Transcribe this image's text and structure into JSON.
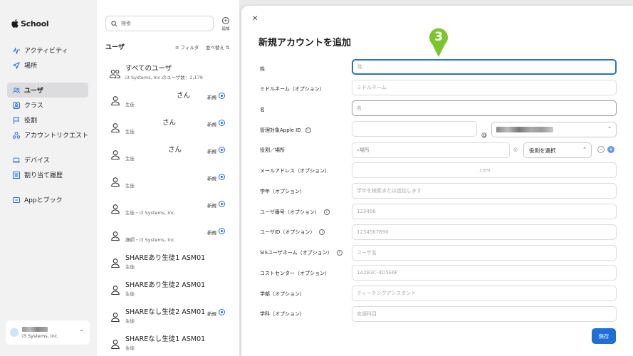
{
  "sidebar": {
    "app_name": "School",
    "items": [
      {
        "label": "アクティビティ",
        "icon": "activity-icon"
      },
      {
        "label": "場所",
        "icon": "location-icon"
      },
      {
        "label": "ユーザ",
        "icon": "users-icon",
        "active": true
      },
      {
        "label": "クラス",
        "icon": "class-icon"
      },
      {
        "label": "役割",
        "icon": "flag-icon"
      },
      {
        "label": "アカウントリクエスト",
        "icon": "account-request-icon"
      },
      {
        "label": "デバイス",
        "icon": "laptop-icon"
      },
      {
        "label": "割り当て履歴",
        "icon": "history-icon"
      },
      {
        "label": "Appとブック",
        "icon": "apps-icon"
      }
    ],
    "account_org": "i3 Systems, Inc."
  },
  "list": {
    "search_placeholder": "検索",
    "add_label": "追加",
    "title": "ユーザ",
    "filter_label": "フィルタ",
    "sort_label": "並べ替え",
    "rows": [
      {
        "name": "すべてのユーザ",
        "sub": "i3 Systems, Inc.のユーザ数：2,179",
        "badge": "",
        "selected": false,
        "icon": "group-icon"
      },
      {
        "name": "さん",
        "sub": "生徒",
        "badge": "新規",
        "selected": true,
        "icon": "person-icon"
      },
      {
        "name": "さん",
        "sub": "生徒",
        "badge": "新規",
        "selected": true,
        "icon": "person-icon"
      },
      {
        "name": "さん",
        "sub": "生徒",
        "badge": "新規",
        "selected": true,
        "icon": "person-icon"
      },
      {
        "name": "",
        "sub": "生徒",
        "badge": "新規",
        "selected": true,
        "icon": "person-icon"
      },
      {
        "name": "",
        "sub": "生徒・i3 Systems, Inc.",
        "badge": "新規",
        "selected": true,
        "icon": "person-icon"
      },
      {
        "name": "",
        "sub": "講師・i3 Systems, Inc.",
        "badge": "新規",
        "selected": true,
        "icon": "person-icon"
      },
      {
        "name": "SHAREあり生徒1 ASM01",
        "sub": "生徒",
        "badge": "",
        "selected": false,
        "icon": "person-icon"
      },
      {
        "name": "SHAREあり生徒2 ASM01",
        "sub": "生徒",
        "badge": "",
        "selected": false,
        "icon": "person-icon"
      },
      {
        "name": "SHAREなし生徒2 ASM01",
        "sub": "生徒",
        "badge": "新規",
        "selected": true,
        "icon": "person-icon"
      },
      {
        "name": "SHAREなし生徒1 ASM01",
        "sub": "生徒",
        "badge": "",
        "selected": false,
        "icon": "person-icon"
      }
    ]
  },
  "form": {
    "title": "新規アカウントを追加",
    "step_number": "3",
    "marker_color": "#7cc52e",
    "fields": {
      "last_name": {
        "label": "姓",
        "placeholder": "姓"
      },
      "middle_name": {
        "label": "ミドルネーム（オプション）",
        "placeholder": "ミドルネーム"
      },
      "first_name": {
        "label": "名",
        "placeholder": "名"
      },
      "apple_id": {
        "label": "管理対象Apple ID",
        "placeholder": "",
        "at": "@"
      },
      "role": {
        "label": "役割／場所",
        "placeholder": "場所",
        "select": "役割を選択"
      },
      "email": {
        "label": "メールアドレス（オプション）",
        "placeholder": ".com"
      },
      "grade": {
        "label": "学年（オプション）",
        "placeholder": "学年を検索または追加します"
      },
      "user_number": {
        "label": "ユーザ番号（オプション）",
        "placeholder": "123456"
      },
      "user_id": {
        "label": "ユーザID（オプション）",
        "placeholder": "1234567890"
      },
      "sis_username": {
        "label": "SISユーザネーム（オプション）",
        "placeholder": "ユーザ名"
      },
      "cost_center": {
        "label": "コストセンター（オプション）",
        "placeholder": "1A2B3C-4D5E6F"
      },
      "department": {
        "label": "学部（オプション）",
        "placeholder": "ティーチングアシスタント"
      },
      "subject": {
        "label": "学科（オプション）",
        "placeholder": "言語科目"
      }
    },
    "save_label": "保存"
  }
}
